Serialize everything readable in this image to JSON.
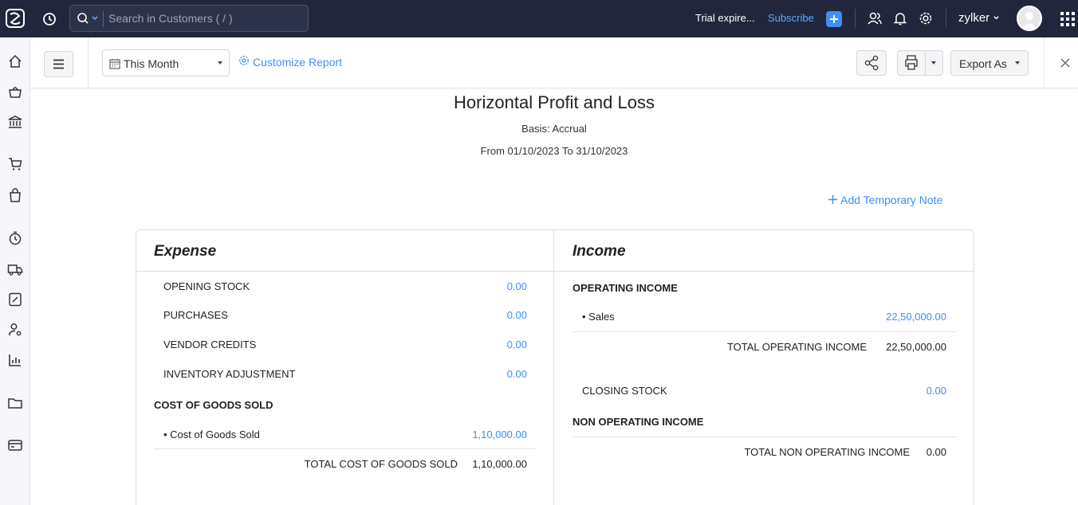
{
  "topbar": {
    "search_placeholder": "Search in Customers ( / )",
    "trial_text": "Trial expire...",
    "subscribe": "Subscribe",
    "org_name": "zylker"
  },
  "toolbar": {
    "period": "This Month",
    "customize": "Customize Report",
    "export": "Export As"
  },
  "report": {
    "title": "Horizontal Profit and Loss",
    "basis": "Basis: Accrual",
    "range": "From 01/10/2023 To 31/10/2023",
    "add_note": "Add Temporary Note",
    "expense": {
      "heading": "Expense",
      "rows": [
        {
          "label": "OPENING STOCK",
          "amount": "0.00"
        },
        {
          "label": "PURCHASES",
          "amount": "0.00"
        },
        {
          "label": "VENDOR CREDITS",
          "amount": "0.00"
        },
        {
          "label": "INVENTORY ADJUSTMENT",
          "amount": "0.00"
        }
      ],
      "cogs_section": "COST OF GOODS SOLD",
      "cogs_item": {
        "label": "• Cost of Goods Sold",
        "amount": "1,10,000.00"
      },
      "cogs_total": {
        "label": "TOTAL COST OF GOODS SOLD",
        "amount": "1,10,000.00"
      }
    },
    "income": {
      "heading": "Income",
      "operating_section": "OPERATING INCOME",
      "sales": {
        "label": "• Sales",
        "amount": "22,50,000.00"
      },
      "operating_total": {
        "label": "TOTAL OPERATING INCOME",
        "amount": "22,50,000.00"
      },
      "closing_stock": {
        "label": "CLOSING STOCK",
        "amount": "0.00"
      },
      "non_operating_section": "NON OPERATING INCOME",
      "non_operating_total": {
        "label": "TOTAL NON OPERATING INCOME",
        "amount": "0.00"
      }
    }
  },
  "colors": {
    "accent": "#408dfb",
    "topbar": "#21263c"
  }
}
